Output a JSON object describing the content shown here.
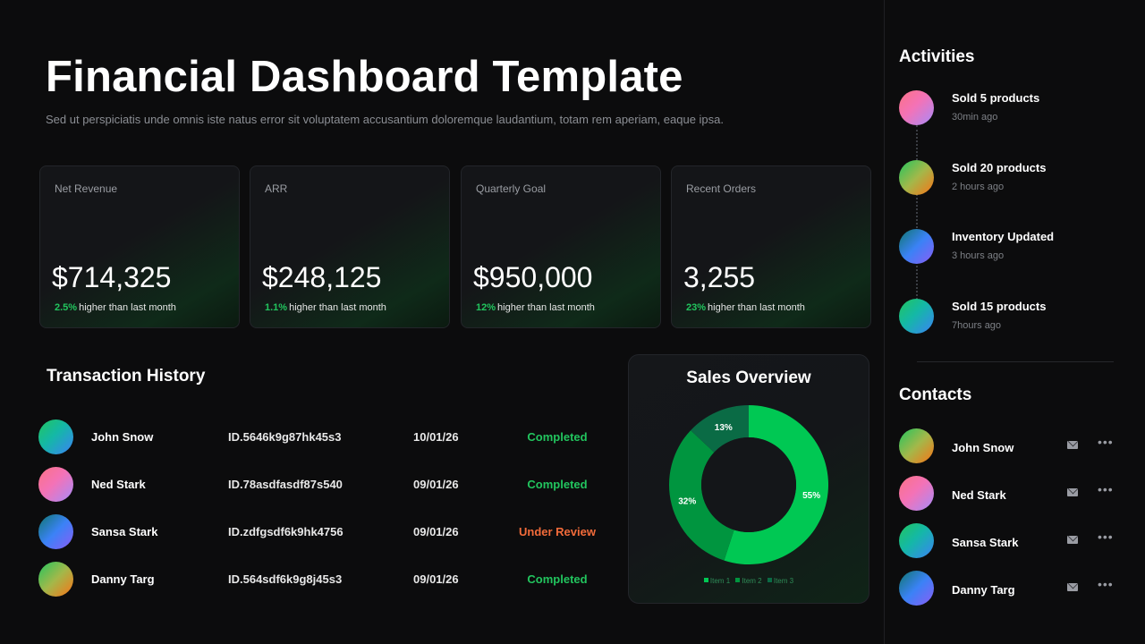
{
  "header": {
    "title": "Financial Dashboard Template",
    "subtitle": "Sed ut perspiciatis unde omnis iste natus error sit voluptatem accusantium doloremque laudantium, totam rem aperiam, eaque ipsa."
  },
  "cards": [
    {
      "label": "Net Revenue",
      "value": "$714,325",
      "pct": "2.5%",
      "note": "higher than last month"
    },
    {
      "label": "ARR",
      "value": "$248,125",
      "pct": "1.1%",
      "note": "higher than last month"
    },
    {
      "label": "Quarterly Goal",
      "value": "$950,000",
      "pct": "12%",
      "note": "higher than last month"
    },
    {
      "label": "Recent Orders",
      "value": "3,255",
      "pct": "23%",
      "note": "higher than last month"
    }
  ],
  "transactions": {
    "title": "Transaction History",
    "rows": [
      {
        "name": "John Snow",
        "id": "ID.5646k9g87hk45s3",
        "date": "10/01/26",
        "status": "Completed"
      },
      {
        "name": "Ned Stark",
        "id": "ID.78asdfasdf87s540",
        "date": "09/01/26",
        "status": "Completed"
      },
      {
        "name": "Sansa Stark",
        "id": "ID.zdfgsdf6k9hk4756",
        "date": "09/01/26",
        "status": "Under Review"
      },
      {
        "name": "Danny Targ",
        "id": "ID.564sdf6k9g8j45s3",
        "date": "09/01/26",
        "status": "Completed"
      }
    ]
  },
  "sales_overview": {
    "title": "Sales Overview",
    "legend": [
      "Item 1",
      "Item 2",
      "Item 3"
    ],
    "colors": [
      "#00c853",
      "#00953f",
      "#0a6b45"
    ]
  },
  "chart_data": {
    "type": "pie",
    "title": "Sales Overview",
    "categories": [
      "Item 1",
      "Item 2",
      "Item 3"
    ],
    "values": [
      55,
      32,
      13
    ],
    "labels": [
      "55%",
      "32%",
      "13%"
    ]
  },
  "activities": {
    "title": "Activities",
    "items": [
      {
        "title": "Sold 5 products",
        "time": "30min ago"
      },
      {
        "title": "Sold 20 products",
        "time": "2 hours ago"
      },
      {
        "title": "Inventory Updated",
        "time": "3 hours ago"
      },
      {
        "title": "Sold 15 products",
        "time": "7hours ago"
      }
    ]
  },
  "contacts": {
    "title": "Contacts",
    "items": [
      {
        "name": "John Snow"
      },
      {
        "name": "Ned Stark"
      },
      {
        "name": "Sansa Stark"
      },
      {
        "name": "Danny Targ"
      }
    ]
  },
  "icons": {
    "mail": "mail-icon",
    "more": "more-options-icon"
  }
}
